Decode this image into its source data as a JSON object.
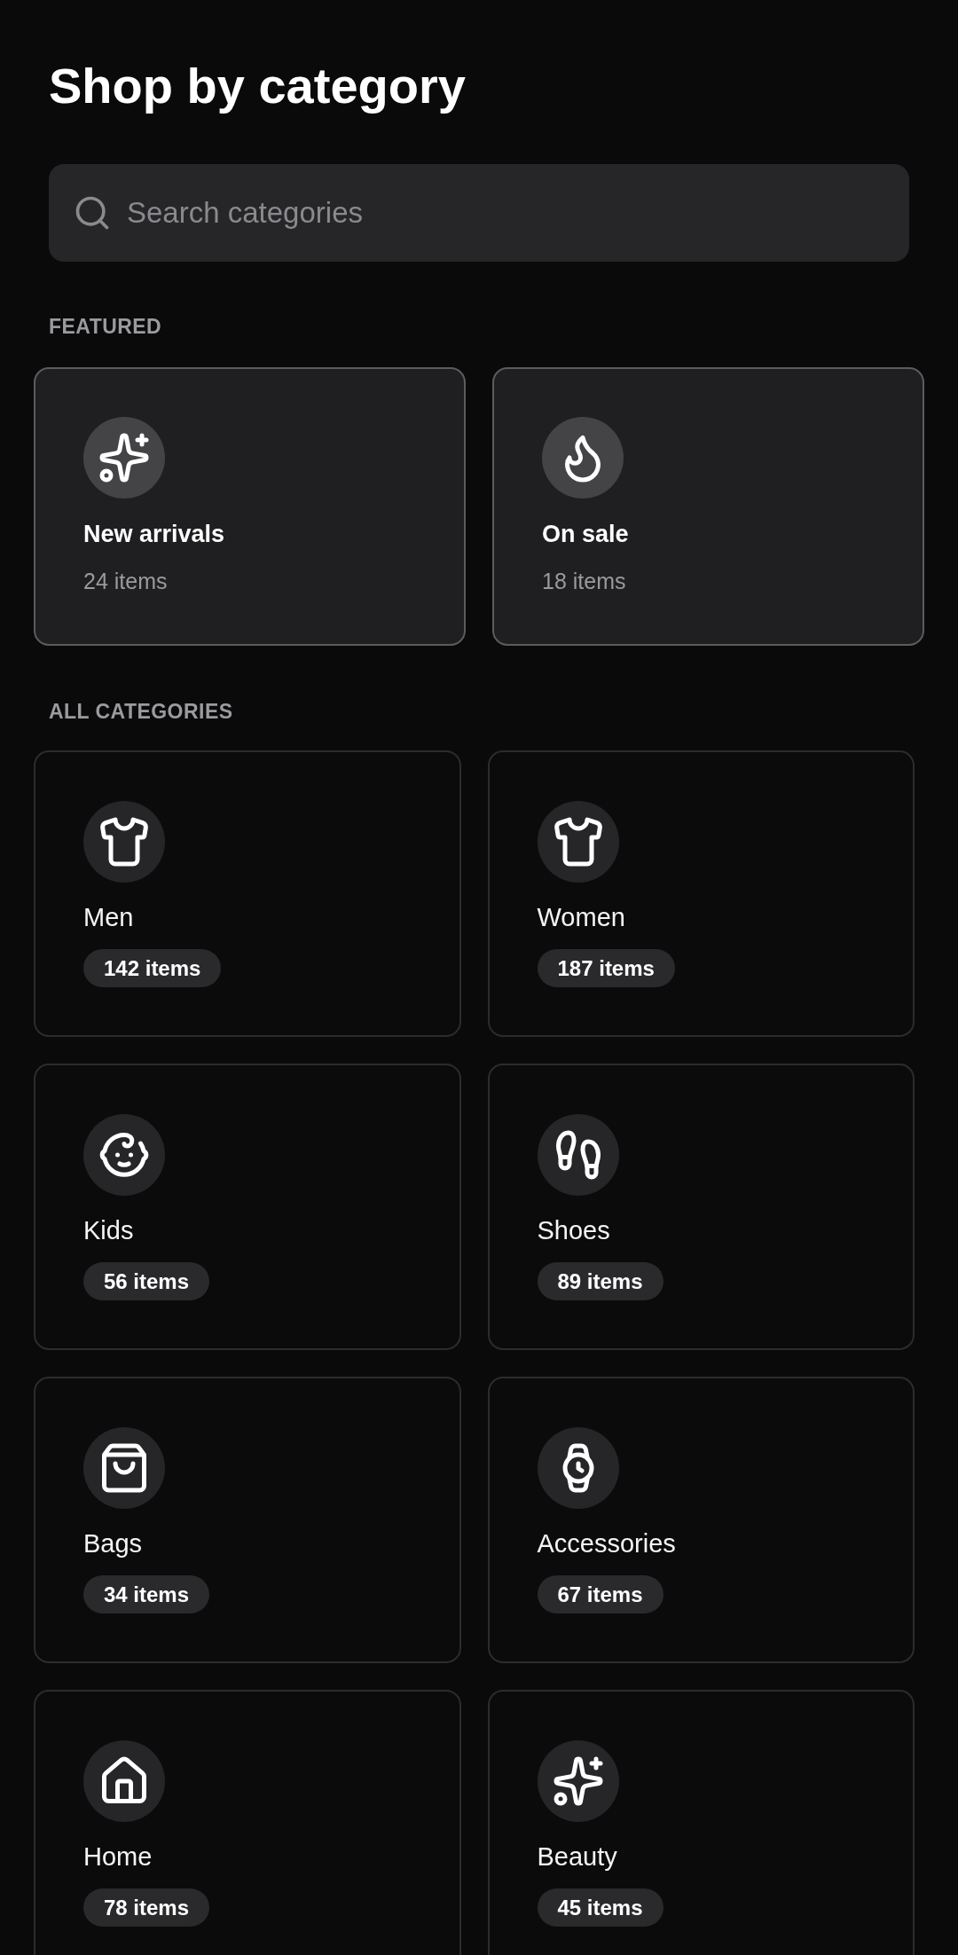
{
  "title": "Shop by category",
  "search": {
    "placeholder": "Search categories"
  },
  "featured": {
    "heading": "FEATURED",
    "items": [
      {
        "kind": "sparkles",
        "name": "New arrivals",
        "count": "24 items"
      },
      {
        "kind": "flame",
        "name": "On sale",
        "count": "18 items"
      }
    ]
  },
  "categories": {
    "heading": "ALL CATEGORIES",
    "items": [
      {
        "kind": "shirt",
        "name": "Men",
        "count": "142 items"
      },
      {
        "kind": "shirt",
        "name": "Women",
        "count": "187 items"
      },
      {
        "kind": "baby",
        "name": "Kids",
        "count": "56 items"
      },
      {
        "kind": "footprints",
        "name": "Shoes",
        "count": "89 items"
      },
      {
        "kind": "bag",
        "name": "Bags",
        "count": "34 items"
      },
      {
        "kind": "watch",
        "name": "Accessories",
        "count": "67 items"
      },
      {
        "kind": "house",
        "name": "Home",
        "count": "78 items"
      },
      {
        "kind": "sparkles",
        "name": "Beauty",
        "count": "45 items"
      }
    ]
  }
}
